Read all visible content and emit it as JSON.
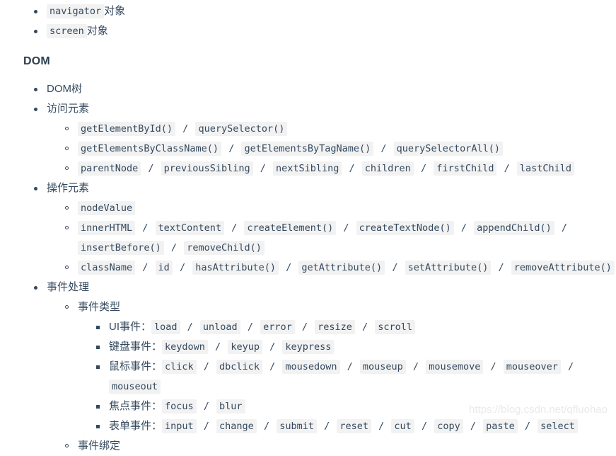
{
  "watermark": "https://blog.csdn.net/qfluohao",
  "top_list": [
    {
      "code": "navigator",
      "text": "对象"
    },
    {
      "code": "screen",
      "text": "对象"
    }
  ],
  "heading": "DOM",
  "dom": {
    "items": [
      {
        "label": "DOM树"
      },
      {
        "label": "访问元素",
        "children": [
          {
            "tokens": [
              "getElementById()",
              "/",
              "querySelector()"
            ]
          },
          {
            "tokens": [
              "getElementsByClassName()",
              "/",
              "getElementsByTagName()",
              "/",
              "querySelectorAll()"
            ]
          },
          {
            "tokens": [
              "parentNode",
              "/",
              "previousSibling",
              "/",
              "nextSibling",
              "/",
              "children",
              "/",
              "firstChild",
              "/",
              "lastChild"
            ]
          }
        ]
      },
      {
        "label": "操作元素",
        "children": [
          {
            "tokens": [
              "nodeValue"
            ]
          },
          {
            "tokens": [
              "innerHTML",
              "/",
              "textContent",
              "/",
              "createElement()",
              "/",
              "createTextNode()",
              "/",
              "appendChild()",
              "/",
              "insertBefore()",
              "/",
              "removeChild()"
            ]
          },
          {
            "tokens": [
              "className",
              "/",
              "id",
              "/",
              "hasAttribute()",
              "/",
              "getAttribute()",
              "/",
              "setAttribute()",
              "/",
              "removeAttribute()"
            ]
          }
        ]
      },
      {
        "label": "事件处理",
        "children": [
          {
            "label": "事件类型",
            "rows": [
              {
                "name": "UI事件",
                "colon": "：",
                "tokens": [
                  "load",
                  "/",
                  "unload",
                  "/",
                  "error",
                  "/",
                  "resize",
                  "/",
                  "scroll"
                ]
              },
              {
                "name": "键盘事件",
                "colon": "：",
                "tokens": [
                  "keydown",
                  "/",
                  "keyup",
                  "/",
                  "keypress"
                ]
              },
              {
                "name": "鼠标事件",
                "colon": "：",
                "tokens": [
                  "click",
                  "/",
                  "dbclick",
                  "/",
                  "mousedown",
                  "/",
                  "mouseup",
                  "/",
                  "mousemove",
                  "/",
                  "mouseover",
                  "/",
                  "mouseout"
                ]
              },
              {
                "name": "焦点事件",
                "colon": "：",
                "tokens": [
                  "focus",
                  "/",
                  "blur"
                ]
              },
              {
                "name": "表单事件",
                "colon": "：",
                "tokens": [
                  "input",
                  "/",
                  "change",
                  "/",
                  "submit",
                  "/",
                  "reset",
                  "/",
                  "cut",
                  "/",
                  "copy",
                  "/",
                  "paste",
                  "/",
                  "select"
                ]
              }
            ]
          },
          {
            "label": "事件绑定"
          }
        ]
      }
    ]
  }
}
